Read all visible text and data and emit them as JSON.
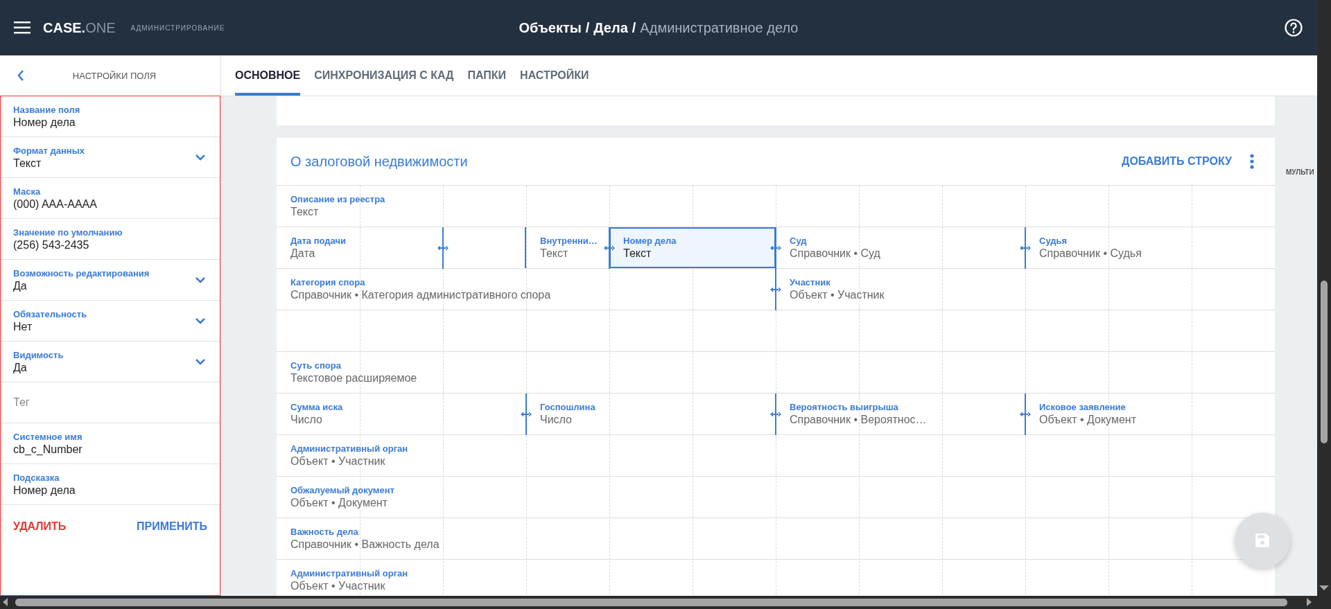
{
  "header": {
    "logo_main": "CASE.",
    "logo_accent": "ONE",
    "subtitle": "АДМИНИСТРИРОВАНИЕ",
    "separator": "/",
    "breadcrumb": [
      {
        "label": "Объекты",
        "current": false
      },
      {
        "label": "Дела",
        "current": false
      },
      {
        "label": "Административное дело",
        "current": true
      }
    ]
  },
  "sidebar": {
    "title": "НАСТРОЙКИ ПОЛЯ",
    "fields": [
      {
        "kind": "text",
        "label": "Название поля",
        "value": "Номер дела"
      },
      {
        "kind": "select",
        "label": "Формат данных",
        "value": "Текст"
      },
      {
        "kind": "text",
        "label": "Маска",
        "value": "(000) AAA-AAAA"
      },
      {
        "kind": "text",
        "label": "Значение по умолчанию",
        "value": "(256) 543-2435"
      },
      {
        "kind": "select",
        "label": "Возможность редактирования",
        "value": "Да"
      },
      {
        "kind": "select",
        "label": "Обязательность",
        "value": "Нет"
      },
      {
        "kind": "select",
        "label": "Видимость",
        "value": "Да"
      },
      {
        "kind": "empty",
        "placeholder": "Тег"
      },
      {
        "kind": "text",
        "label": "Системное имя",
        "value": "cb_c_Number"
      },
      {
        "kind": "text",
        "label": "Подсказка",
        "value": "Номер дела"
      }
    ],
    "actions": [
      {
        "kind": "danger",
        "label": "УДАЛИТЬ"
      },
      {
        "kind": "primary",
        "label": "ПРИМЕНИТЬ"
      }
    ]
  },
  "tabs": [
    {
      "label": "ОСНОВНОЕ",
      "selected": true
    },
    {
      "label": "СИНХРОНИЗАЦИЯ С КАД",
      "selected": false
    },
    {
      "label": "ПАПКИ",
      "selected": false
    },
    {
      "label": "НАСТРОЙКИ",
      "selected": false
    }
  ],
  "section": {
    "title": "О залоговой недвижимости",
    "add_button": "ДОБАВИТЬ СТРОКУ",
    "side_label": "МУЛЬТИ",
    "lines": [
      {
        "kind": "fields",
        "fields": [
          {
            "kind": "field",
            "label": "Описание из реестра",
            "value": "Текст",
            "resizer": false,
            "selected": false
          }
        ]
      },
      {
        "kind": "fields",
        "fields": [
          {
            "kind": "field",
            "label": "Дата подачи",
            "value": "Дата",
            "resizer": true,
            "selected": false
          },
          {
            "kind": "spacer"
          },
          {
            "kind": "field",
            "label": "Внутренни…",
            "value": "Текст",
            "resizer": true,
            "selected": false
          },
          {
            "kind": "field",
            "label": "Номер дела",
            "value": "Текст",
            "resizer": true,
            "selected": true
          },
          {
            "kind": "field",
            "label": "Суд",
            "value": "Справочник • Суд",
            "resizer": true,
            "selected": false
          },
          {
            "kind": "field",
            "label": "Судья",
            "value": "Справочник • Судья",
            "resizer": false,
            "selected": false
          }
        ]
      },
      {
        "kind": "fields",
        "fields": [
          {
            "kind": "field",
            "label": "Категория спора",
            "value": "Справочник • Категория административного спора",
            "resizer": true,
            "selected": false
          },
          {
            "kind": "field",
            "label": "Участник",
            "value": "Объект • Участник",
            "resizer": false,
            "selected": false
          }
        ]
      },
      {
        "kind": "empty"
      },
      {
        "kind": "fields",
        "fields": [
          {
            "kind": "field",
            "label": "Суть спора",
            "value": "Текстовое расширяемое",
            "resizer": false,
            "selected": false
          }
        ]
      },
      {
        "kind": "fields",
        "fields": [
          {
            "kind": "field",
            "label": "Сумма иска",
            "value": "Число",
            "resizer": true,
            "selected": false
          },
          {
            "kind": "field",
            "label": "Госпошлина",
            "value": "Число",
            "resizer": true,
            "selected": false
          },
          {
            "kind": "field",
            "label": "Вероятность выигрыша",
            "value": "Справочник • Вероятнос…",
            "resizer": true,
            "selected": false
          },
          {
            "kind": "field",
            "label": "Исковое заявление",
            "value": "Объект • Документ",
            "resizer": false,
            "selected": false
          }
        ]
      },
      {
        "kind": "fields",
        "fields": [
          {
            "kind": "field",
            "label": "Административный орган",
            "value": "Объект • Участник",
            "resizer": false,
            "selected": false
          }
        ]
      },
      {
        "kind": "fields",
        "fields": [
          {
            "kind": "field",
            "label": "Обжалуемый документ",
            "value": "Объект • Документ",
            "resizer": false,
            "selected": false
          }
        ]
      },
      {
        "kind": "fields",
        "fields": [
          {
            "kind": "field",
            "label": "Важность дела",
            "value": "Справочник • Важность дела",
            "resizer": false,
            "selected": false
          }
        ]
      },
      {
        "kind": "fields",
        "fields": [
          {
            "kind": "field",
            "label": "Административный орган",
            "value": "Объект • Участник",
            "resizer": false,
            "selected": false
          }
        ]
      }
    ]
  }
}
